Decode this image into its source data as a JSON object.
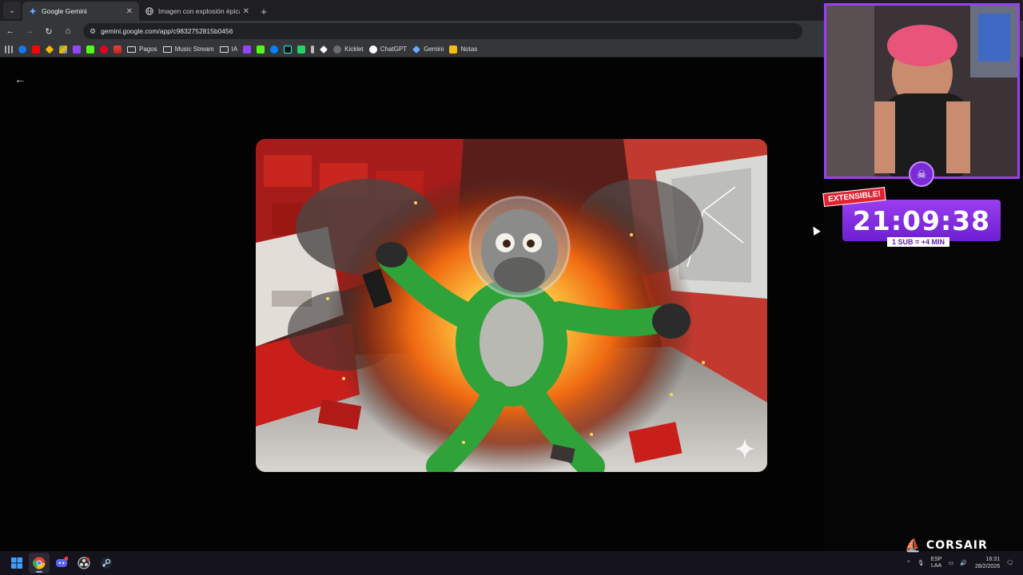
{
  "tabs": [
    {
      "title": "Google Gemini",
      "active": true
    },
    {
      "title": "Imagen con explosión épica",
      "active": false
    }
  ],
  "address_bar": {
    "url": "gemini.google.com/app/c9832752815b0456"
  },
  "bookmarks": [
    {
      "label": "Pagos",
      "icon": "folder-icon"
    },
    {
      "label": "Music Stream",
      "icon": "folder-icon"
    },
    {
      "label": "IA",
      "icon": "folder-icon"
    },
    {
      "label": "Kicklet",
      "icon": "kicklet-icon"
    },
    {
      "label": "ChatGPT",
      "icon": "chatgpt-icon"
    },
    {
      "label": "Gemini",
      "icon": "gemini-icon"
    },
    {
      "label": "Notas",
      "icon": "notes-icon"
    }
  ],
  "overlay": {
    "extensible_label": "EXTENSIBLE!",
    "timer": "21:09:38",
    "sub_note": "1 SUB = +4 MIN",
    "sponsor": "CORSAIR"
  },
  "tray": {
    "lang_line1": "ESP",
    "lang_line2": "LAA",
    "time": "16:31",
    "date": "28/2/2026"
  },
  "colors": {
    "overlay_purple": "#8f35e8",
    "badge_red": "#e32030",
    "browser_chrome": "#35363a"
  }
}
